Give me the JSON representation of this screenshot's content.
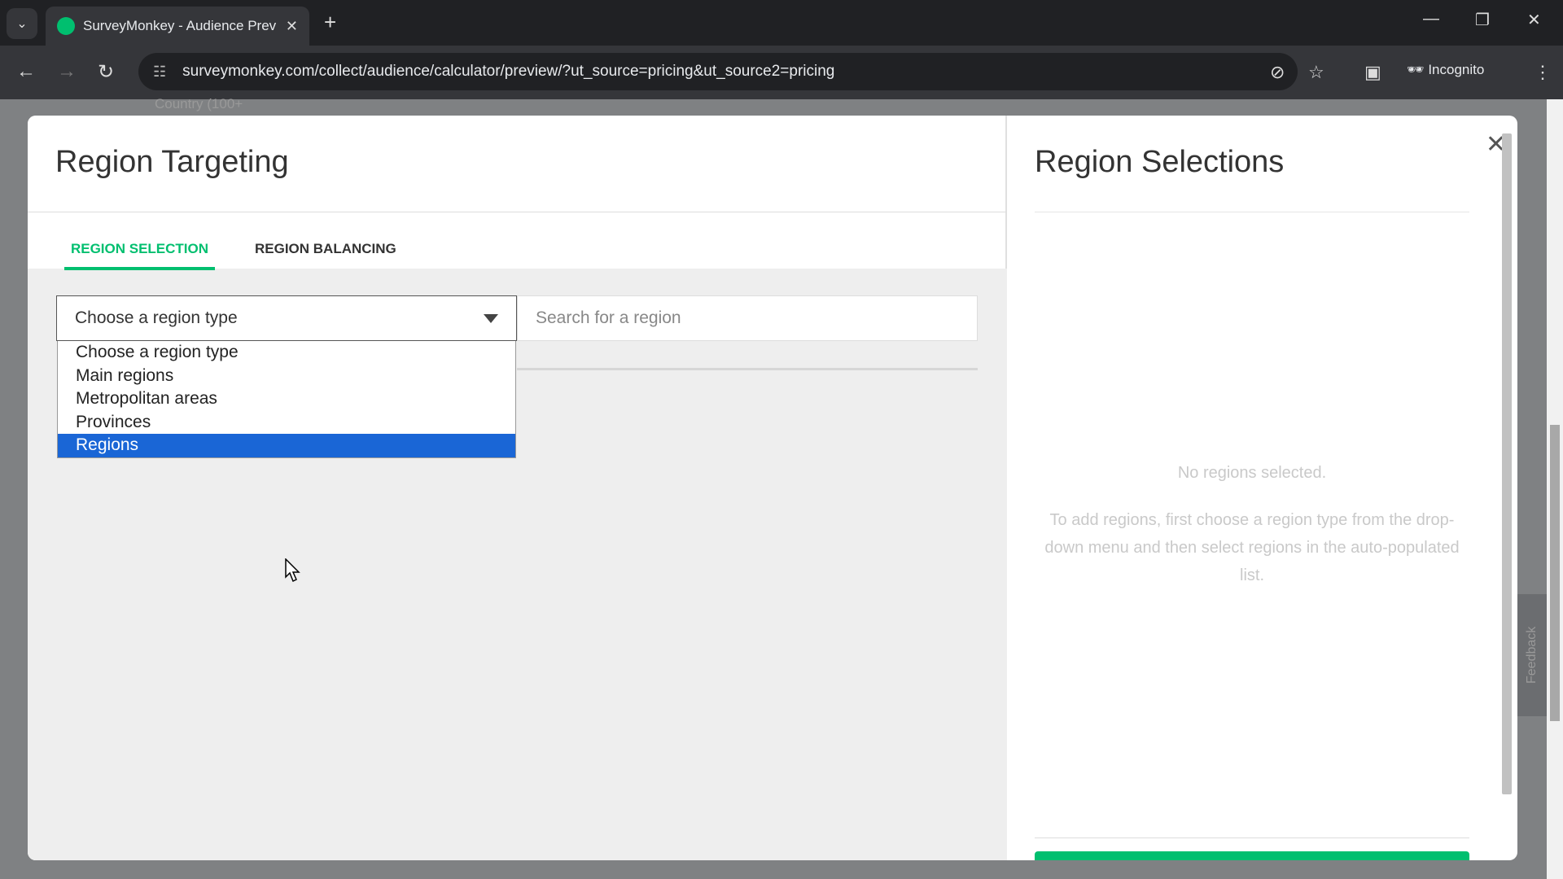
{
  "browser": {
    "tab_title": "SurveyMonkey - Audience Prev",
    "url": "surveymonkey.com/collect/audience/calculator/preview/?ut_source=pricing&ut_source2=pricing",
    "incognito_label": "Incognito"
  },
  "background": {
    "partial_text": "Country (100+"
  },
  "modal": {
    "title": "Region Targeting",
    "tabs": [
      {
        "label": "REGION SELECTION",
        "active": true
      },
      {
        "label": "REGION BALANCING",
        "active": false
      }
    ],
    "region_type_select": {
      "value": "Choose a region type",
      "options": [
        "Choose a region type",
        "Main regions",
        "Metropolitan areas",
        "Provinces",
        "Regions"
      ],
      "highlighted": "Regions"
    },
    "search": {
      "placeholder": "Search for a region",
      "value": ""
    },
    "selections": {
      "title": "Region Selections",
      "empty_title": "No regions selected.",
      "empty_help": "To add regions, first choose a region type from the drop-down menu and then select regions in the auto-populated list."
    },
    "feedback_label": "Feedback"
  },
  "colors": {
    "accent": "#00bf6f",
    "highlight": "#1a66d6"
  }
}
